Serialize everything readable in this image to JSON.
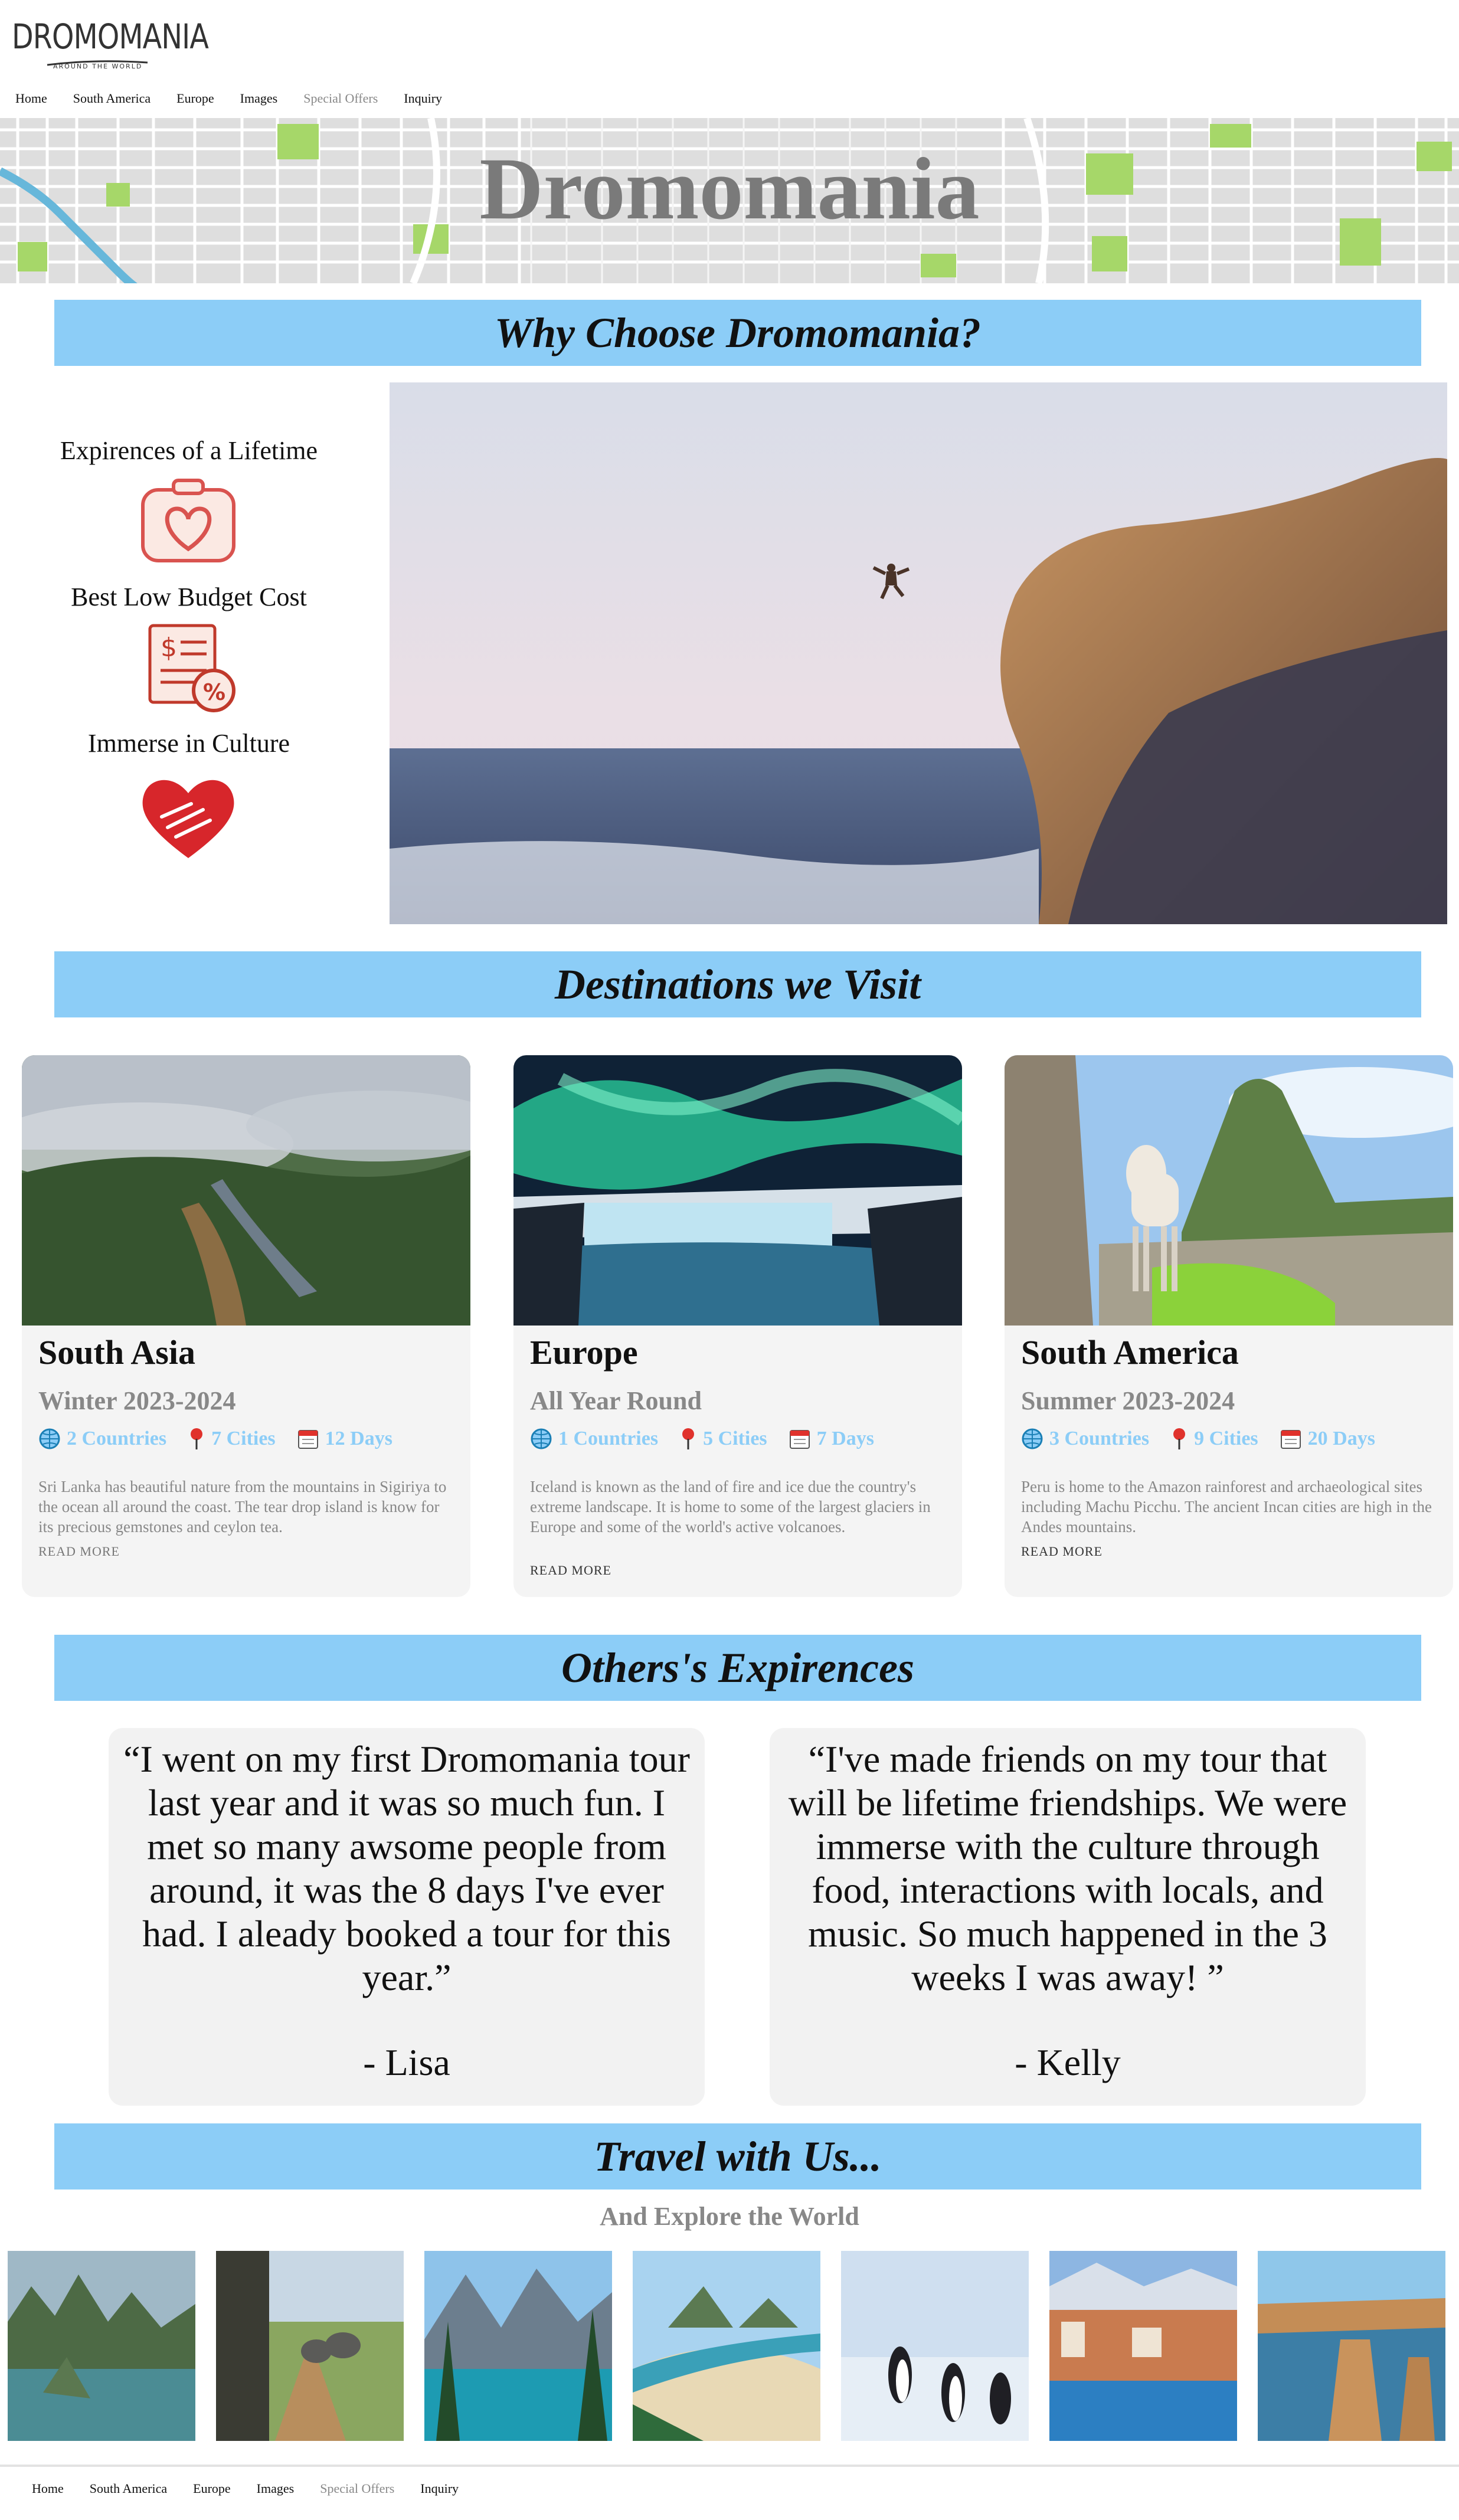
{
  "brand": {
    "logo_name": "DROMOMANIA",
    "logo_tagline": "AROUND THE WORLD"
  },
  "nav": [
    {
      "label": "Home",
      "muted": false
    },
    {
      "label": "South America",
      "muted": false
    },
    {
      "label": "Europe",
      "muted": false
    },
    {
      "label": "Images",
      "muted": false
    },
    {
      "label": "Special Offers",
      "muted": true
    },
    {
      "label": "Inquiry",
      "muted": false
    }
  ],
  "hero": {
    "title": "Dromomania"
  },
  "why": {
    "heading": "Why Choose Dromomania?",
    "features": [
      {
        "label": "Expirences of a Lifetime",
        "icon": "camera-heart-icon"
      },
      {
        "label": "Best Low Budget Cost",
        "icon": "discount-receipt-icon"
      },
      {
        "label": "Immerse in Culture",
        "icon": "hands-heart-icon"
      }
    ]
  },
  "destinations": {
    "heading": "Destinations we Visit",
    "cards": [
      {
        "title": "South Asia",
        "season": "Winter 2023-2024",
        "countries": "2 Countries",
        "cities": "7 Cities",
        "days": "12 Days",
        "description": "Sri Lanka has beautiful nature from the mountains in Sigiriya to the ocean all around the coast. The tear drop island is know for its precious gemstones and ceylon tea.",
        "read_more": "READ MORE"
      },
      {
        "title": "Europe",
        "season": "All Year Round",
        "countries": "1 Countries",
        "cities": "5 Cities",
        "days": "7 Days",
        "description": "Iceland is known as the land of fire and ice due the country's extreme landscape. It is home to some of the largest glaciers in Europe and some of the world's active volcanoes.",
        "read_more": "READ MORE"
      },
      {
        "title": "South America",
        "season": "Summer 2023-2024",
        "countries": "3 Countries",
        "cities": "9 Cities",
        "days": "20 Days",
        "description": "Peru is home to the Amazon rainforest and archaeological sites including Machu Picchu. The ancient Incan cities are high in the Andes mountains.",
        "read_more": "READ MORE"
      }
    ]
  },
  "testimonials": {
    "heading": "Others's Expirences",
    "items": [
      {
        "quote": "“I went on my first Dromomania tour last year and it was so much fun. I met so many awsome people from around, it was the 8 days I've ever had. I aleady booked a tour for this year.”",
        "author": "- Lisa"
      },
      {
        "quote": "“I've made friends on my tour that will be lifetime friendships. We were immerse with the culture through food, interactions with locals, and music. So much happened in the 3 weeks I was away! ”",
        "author": "- Kelly"
      }
    ]
  },
  "travel": {
    "heading": "Travel with Us...",
    "subheading": "And Explore the World"
  },
  "colors": {
    "banner": "#8ccdf7",
    "accent_text": "#8ccdf7",
    "muted_text": "#888888",
    "card_bg": "#f4f4f4"
  }
}
